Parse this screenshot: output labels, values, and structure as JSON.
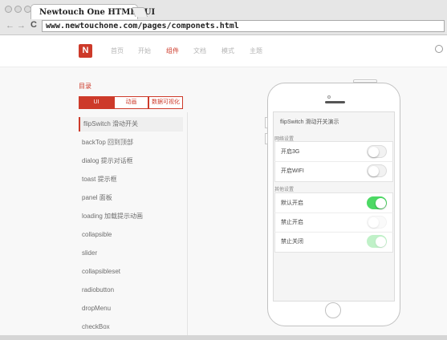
{
  "browser": {
    "tab_title": "Newtouch One HTML5 UI",
    "url": "www.newtouchone.com/pages/componets.html",
    "back_glyph": "←",
    "forward_glyph": "→",
    "reload_glyph": "C"
  },
  "header": {
    "logo_text": "N",
    "nav": [
      "首页",
      "开始",
      "组件",
      "文档",
      "模式",
      "主题"
    ],
    "active_nav": "组件",
    "brand_color": "#cd3a2a"
  },
  "sidebar": {
    "title": "目录",
    "tabs": [
      "UI",
      "动画",
      "数据可视化"
    ],
    "active_tab": "UI",
    "items": [
      "flipSwitch 滑动开关",
      "backTop 回到顶部",
      "dialog 提示对话框",
      "toast 提示框",
      "panel 面板",
      "loading 加载提示动画",
      "collapsible",
      "slider",
      "collapsibleset",
      "radiobutton",
      "dropMenu",
      "checkBox"
    ],
    "active_item": "flipSwitch 滑动开关"
  },
  "demo": {
    "title": "flipSwitch 滑动开关演示",
    "sections": [
      {
        "label": "网络设置",
        "rows": [
          {
            "label": "开启3G",
            "state": "off"
          },
          {
            "label": "开启WIFI",
            "state": "off"
          }
        ]
      },
      {
        "label": "其他设置",
        "rows": [
          {
            "label": "默认开启",
            "state": "on"
          },
          {
            "label": "禁止开启",
            "state": "disabled-off"
          },
          {
            "label": "禁止关闭",
            "state": "disabled-on"
          }
        ]
      }
    ],
    "on_color": "#4cd964"
  }
}
